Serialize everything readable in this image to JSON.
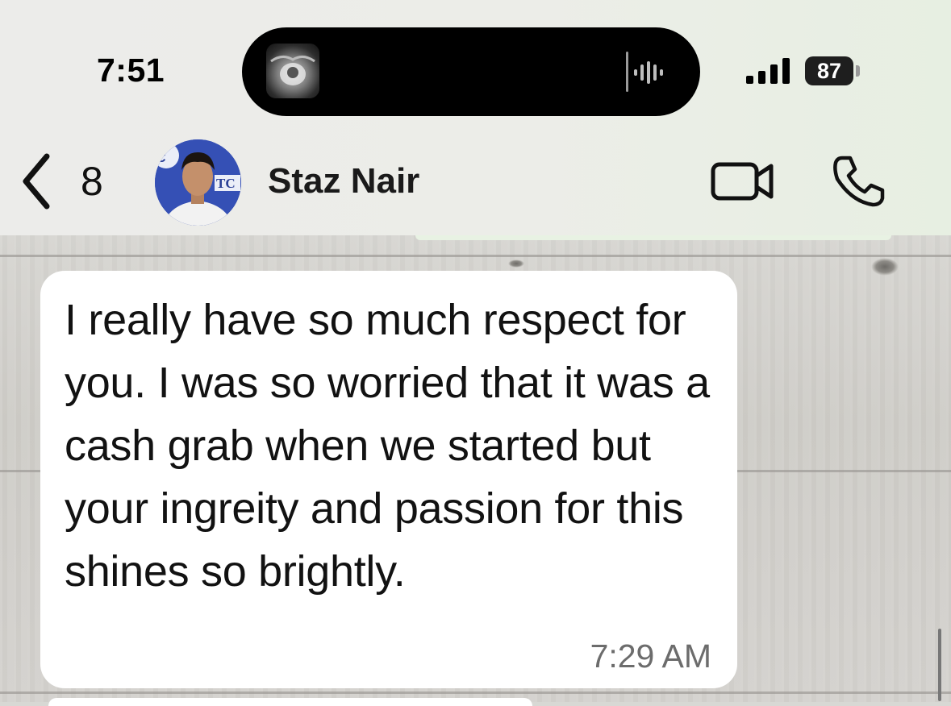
{
  "status_bar": {
    "time": "7:51",
    "battery": "87",
    "signal_icon": "cellular-signal-icon"
  },
  "dynamic_island": {
    "thumbnail_icon": "now-playing-thumbnail",
    "waveform_icon": "audio-waveform-icon"
  },
  "header": {
    "back_count": "8",
    "contact_name": "Staz Nair",
    "video_icon": "video-camera-icon",
    "phone_icon": "phone-icon"
  },
  "messages": [
    {
      "text": "I really have so much respect for you. I was so worried that it was a cash grab when we started but your ingreity and passion for this shines so brightly.",
      "time": "7:29 AM",
      "direction": "incoming"
    }
  ],
  "colors": {
    "header_bg": "#ececea",
    "bubble_bg": "#ffffff",
    "timestamp": "#6c6c6c",
    "avatar_bg": "#3550b5"
  }
}
